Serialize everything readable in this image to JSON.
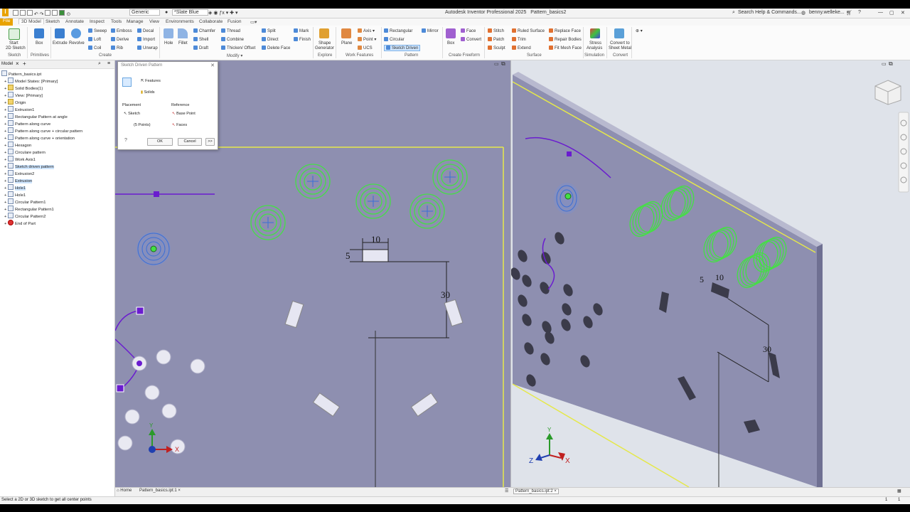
{
  "app": {
    "title": "Autodesk Inventor Professional 2025",
    "document": "Pattern_basics2",
    "search_placeholder": "Search Help & Commands...",
    "user": "benny.welleke...",
    "material": "Generic",
    "appearance": "*Slate Blue"
  },
  "ribbon_tabs": [
    "File",
    "3D Model",
    "Sketch",
    "Annotate",
    "Inspect",
    "Tools",
    "Manage",
    "View",
    "Environments",
    "Collaborate",
    "Fusion"
  ],
  "ribbon": {
    "sketch": {
      "start": "Start",
      "start2": "2D Sketch",
      "group": "Sketch"
    },
    "primitives": {
      "box": "Box",
      "group": "Primitives"
    },
    "create": {
      "extrude": "Extrude",
      "revolve": "Revolve",
      "sweep": "Sweep",
      "loft": "Loft",
      "coil": "Coil",
      "emboss": "Emboss",
      "derive": "Derive",
      "rib": "Rib",
      "decal": "Decal",
      "import": "Import",
      "unwrap": "Unwrap",
      "group": "Create"
    },
    "modify": {
      "hole": "Hole",
      "fillet": "Fillet",
      "chamfer": "Chamfer",
      "shell": "Shell",
      "draft": "Draft",
      "thread": "Thread",
      "combine": "Combine",
      "thicken": "Thicken/ Offset",
      "split": "Split",
      "direct": "Direct",
      "delete_face": "Delete Face",
      "mark": "Mark",
      "finish": "Finish",
      "group": "Modify"
    },
    "explore": {
      "shape": "Shape",
      "generator": "Generator",
      "group": "Explore"
    },
    "work": {
      "plane": "Plane",
      "axis": "Axis",
      "point": "Point",
      "ucs": "UCS",
      "group": "Work Features"
    },
    "pattern": {
      "rectangular": "Rectangular",
      "circular": "Circular",
      "sketch_driven": "Sketch Driven",
      "mirror": "Mirror",
      "group": "Pattern"
    },
    "freeform": {
      "box": "Box",
      "face": "Face",
      "convert": "Convert",
      "group": "Create Freeform"
    },
    "surface": {
      "stitch": "Stitch",
      "patch": "Patch",
      "sculpt": "Sculpt",
      "ruled": "Ruled Surface",
      "trim": "Trim",
      "extend": "Extend",
      "replace": "Replace Face",
      "repair": "Repair Bodies",
      "fit_mesh": "Fit Mesh Face",
      "group": "Surface"
    },
    "simulation": {
      "stress": "Stress",
      "analysis": "Analysis",
      "group": "Simulation"
    },
    "convert": {
      "to_sheet": "Convert to",
      "sheet_metal": "Sheet Metal",
      "group": "Convert"
    }
  },
  "browser": {
    "tab": "Model",
    "items": [
      {
        "label": "Pattern_basics.ipt",
        "indent": 0,
        "sel": false
      },
      {
        "label": "Model States: [Primary]",
        "indent": 1,
        "sel": false
      },
      {
        "label": "Solid Bodies(1)",
        "indent": 1,
        "sel": false
      },
      {
        "label": "View: [Primary]",
        "indent": 1,
        "sel": false
      },
      {
        "label": "Origin",
        "indent": 1,
        "sel": false
      },
      {
        "label": "Extrusion1",
        "indent": 1,
        "sel": false
      },
      {
        "label": "Rectangular Pattern at angle",
        "indent": 1,
        "sel": false
      },
      {
        "label": "Pattern along curve",
        "indent": 1,
        "sel": false
      },
      {
        "label": "Pattern along curve + circular pattern",
        "indent": 1,
        "sel": false
      },
      {
        "label": "Pattern along curve + orientation",
        "indent": 1,
        "sel": false
      },
      {
        "label": "Hexagon",
        "indent": 1,
        "sel": false
      },
      {
        "label": "Circulare pattern",
        "indent": 1,
        "sel": false
      },
      {
        "label": "Work Axis1",
        "indent": 1,
        "sel": false
      },
      {
        "label": "Sketch driven pattern",
        "indent": 1,
        "sel": true
      },
      {
        "label": "Extrusion2",
        "indent": 1,
        "sel": false
      },
      {
        "label": "Extrusion",
        "indent": 1,
        "sel": true
      },
      {
        "label": "Hole1",
        "indent": 1,
        "sel": true
      },
      {
        "label": "Hole1",
        "indent": 1,
        "sel": false
      },
      {
        "label": "Circular Pattern1",
        "indent": 1,
        "sel": false
      },
      {
        "label": "Rectangular Pattern1",
        "indent": 1,
        "sel": false
      },
      {
        "label": "Circular Pattern2",
        "indent": 1,
        "sel": false
      },
      {
        "label": "End of Part",
        "indent": 1,
        "sel": false
      }
    ]
  },
  "dialog": {
    "title": "Sketch Driven Pattern",
    "features": "Features",
    "solids": "Solids",
    "placement": "Placement",
    "sketch": "Sketch",
    "points": "(5 Points)",
    "reference": "Reference",
    "base_point": "Base Point",
    "faces": "Faces",
    "ok": "OK",
    "cancel": "Cancel",
    "more": ">>"
  },
  "viewport1": {
    "dim_width": "10",
    "dim_height": "5",
    "dim_offset": "30",
    "axis_x": "X",
    "axis_y": "Y"
  },
  "viewport2": {
    "dim_width": "10",
    "dim_height": "5",
    "dim_offset": "30",
    "axis_x": "X",
    "axis_y": "Y",
    "axis_z": "Z"
  },
  "doc_tabs": {
    "home": "Home",
    "tab1": "Pattern_basics.ipt:1",
    "tab2": "Pattern_basics.ipt:2"
  },
  "status": {
    "message": "Select a 2D or 3D sketch to get all center points",
    "n1": "1",
    "n2": "1"
  },
  "colors": {
    "part_face": "#8e8fb0",
    "sketch_green": "#44e044",
    "sketch_purple": "#6a1ccf",
    "hole_blue": "#3b6fd6",
    "edge_yellow": "#e5e84a"
  }
}
